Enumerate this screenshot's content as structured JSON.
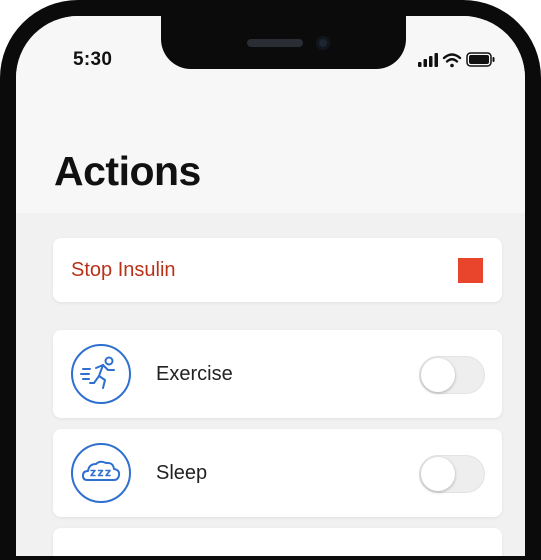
{
  "status_bar": {
    "time": "5:30",
    "icons": [
      "signal-icon",
      "wifi-icon",
      "battery-icon"
    ]
  },
  "header": {
    "title": "Actions"
  },
  "stop_insulin": {
    "label": "Stop Insulin",
    "icon": "stop-icon",
    "color": "#e9452c"
  },
  "actions": [
    {
      "label": "Exercise",
      "icon": "running-person-icon",
      "enabled": false
    },
    {
      "label": "Sleep",
      "icon": "sleep-cloud-icon",
      "enabled": false
    }
  ],
  "colors": {
    "accent_blue": "#2f6fcf",
    "stop_red": "#e9452c",
    "stop_text": "#b8321a"
  }
}
